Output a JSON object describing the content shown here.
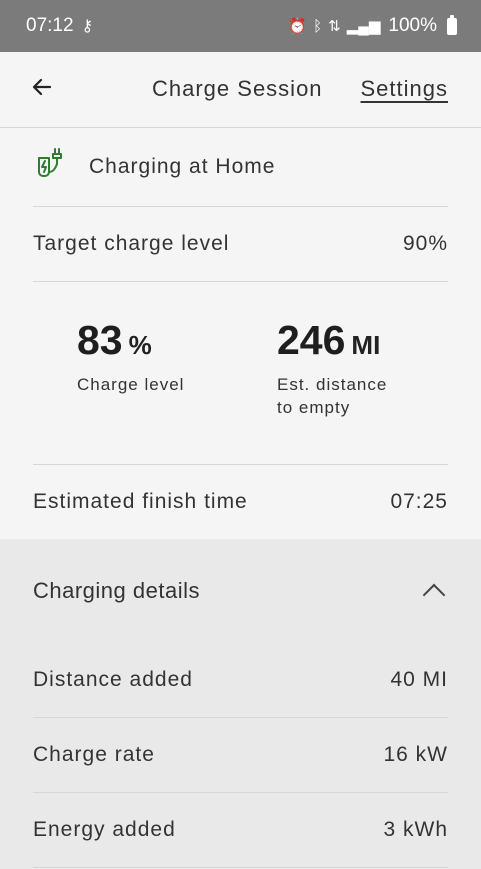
{
  "status_bar": {
    "time": "07:12",
    "battery": "100%",
    "icons": [
      "key-icon",
      "alarm-icon",
      "bluetooth-icon",
      "data-icon",
      "signal-icon",
      "battery-icon"
    ]
  },
  "header": {
    "title": "Charge Session",
    "settings_label": "Settings"
  },
  "location": {
    "label": "Charging at Home",
    "icon": "charging-plug-icon",
    "icon_color": "#2e7d32"
  },
  "target": {
    "label": "Target charge level",
    "value": "90%"
  },
  "stats": {
    "charge_value": "83",
    "charge_unit": "%",
    "charge_label": "Charge level",
    "range_value": "246",
    "range_unit": "MI",
    "range_label": "Est. distance to empty"
  },
  "finish": {
    "label": "Estimated finish time",
    "value": "07:25"
  },
  "details": {
    "title": "Charging details",
    "rows": [
      {
        "label": "Distance added",
        "value": "40 MI"
      },
      {
        "label": "Charge rate",
        "value": "16 kW"
      },
      {
        "label": "Energy added",
        "value": "3 kWh"
      }
    ]
  }
}
